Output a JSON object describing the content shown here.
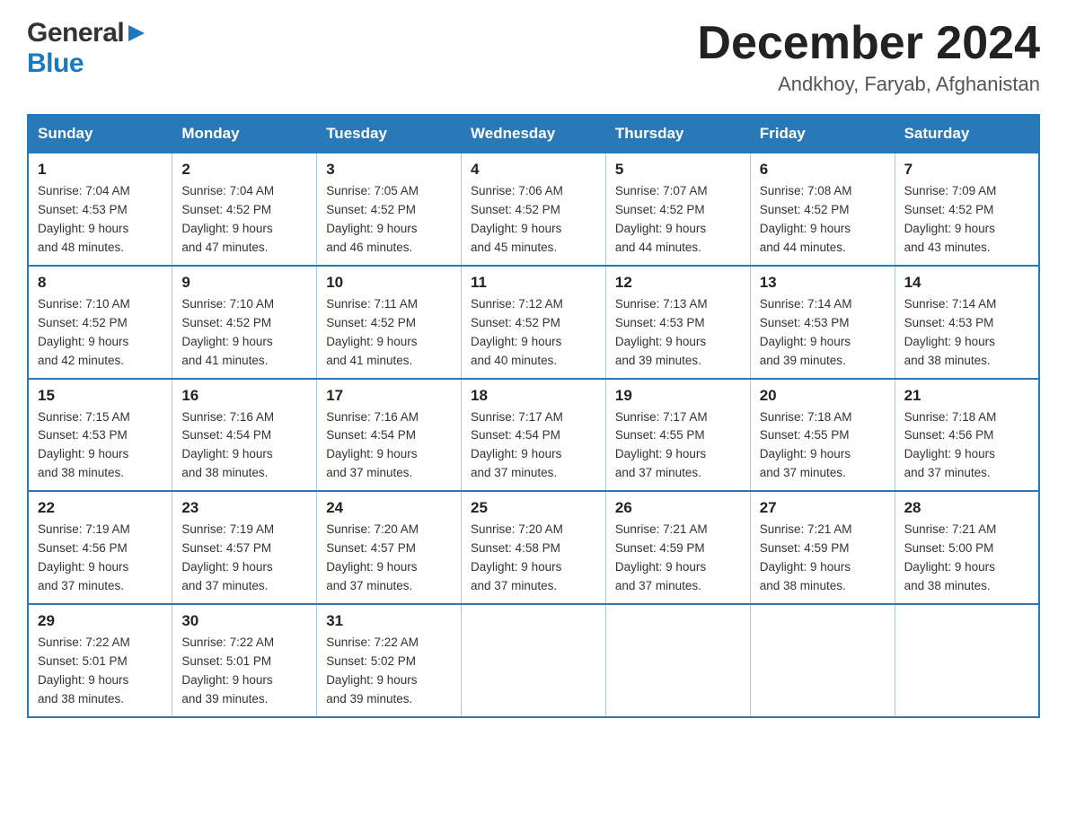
{
  "header": {
    "logo": {
      "general": "General",
      "blue": "Blue",
      "arrow_unicode": "▶"
    },
    "title": "December 2024",
    "location": "Andkhoy, Faryab, Afghanistan"
  },
  "calendar": {
    "days_of_week": [
      "Sunday",
      "Monday",
      "Tuesday",
      "Wednesday",
      "Thursday",
      "Friday",
      "Saturday"
    ],
    "weeks": [
      [
        {
          "date": "1",
          "sunrise": "7:04 AM",
          "sunset": "4:53 PM",
          "daylight": "9 hours and 48 minutes."
        },
        {
          "date": "2",
          "sunrise": "7:04 AM",
          "sunset": "4:52 PM",
          "daylight": "9 hours and 47 minutes."
        },
        {
          "date": "3",
          "sunrise": "7:05 AM",
          "sunset": "4:52 PM",
          "daylight": "9 hours and 46 minutes."
        },
        {
          "date": "4",
          "sunrise": "7:06 AM",
          "sunset": "4:52 PM",
          "daylight": "9 hours and 45 minutes."
        },
        {
          "date": "5",
          "sunrise": "7:07 AM",
          "sunset": "4:52 PM",
          "daylight": "9 hours and 44 minutes."
        },
        {
          "date": "6",
          "sunrise": "7:08 AM",
          "sunset": "4:52 PM",
          "daylight": "9 hours and 44 minutes."
        },
        {
          "date": "7",
          "sunrise": "7:09 AM",
          "sunset": "4:52 PM",
          "daylight": "9 hours and 43 minutes."
        }
      ],
      [
        {
          "date": "8",
          "sunrise": "7:10 AM",
          "sunset": "4:52 PM",
          "daylight": "9 hours and 42 minutes."
        },
        {
          "date": "9",
          "sunrise": "7:10 AM",
          "sunset": "4:52 PM",
          "daylight": "9 hours and 41 minutes."
        },
        {
          "date": "10",
          "sunrise": "7:11 AM",
          "sunset": "4:52 PM",
          "daylight": "9 hours and 41 minutes."
        },
        {
          "date": "11",
          "sunrise": "7:12 AM",
          "sunset": "4:52 PM",
          "daylight": "9 hours and 40 minutes."
        },
        {
          "date": "12",
          "sunrise": "7:13 AM",
          "sunset": "4:53 PM",
          "daylight": "9 hours and 39 minutes."
        },
        {
          "date": "13",
          "sunrise": "7:14 AM",
          "sunset": "4:53 PM",
          "daylight": "9 hours and 39 minutes."
        },
        {
          "date": "14",
          "sunrise": "7:14 AM",
          "sunset": "4:53 PM",
          "daylight": "9 hours and 38 minutes."
        }
      ],
      [
        {
          "date": "15",
          "sunrise": "7:15 AM",
          "sunset": "4:53 PM",
          "daylight": "9 hours and 38 minutes."
        },
        {
          "date": "16",
          "sunrise": "7:16 AM",
          "sunset": "4:54 PM",
          "daylight": "9 hours and 38 minutes."
        },
        {
          "date": "17",
          "sunrise": "7:16 AM",
          "sunset": "4:54 PM",
          "daylight": "9 hours and 37 minutes."
        },
        {
          "date": "18",
          "sunrise": "7:17 AM",
          "sunset": "4:54 PM",
          "daylight": "9 hours and 37 minutes."
        },
        {
          "date": "19",
          "sunrise": "7:17 AM",
          "sunset": "4:55 PM",
          "daylight": "9 hours and 37 minutes."
        },
        {
          "date": "20",
          "sunrise": "7:18 AM",
          "sunset": "4:55 PM",
          "daylight": "9 hours and 37 minutes."
        },
        {
          "date": "21",
          "sunrise": "7:18 AM",
          "sunset": "4:56 PM",
          "daylight": "9 hours and 37 minutes."
        }
      ],
      [
        {
          "date": "22",
          "sunrise": "7:19 AM",
          "sunset": "4:56 PM",
          "daylight": "9 hours and 37 minutes."
        },
        {
          "date": "23",
          "sunrise": "7:19 AM",
          "sunset": "4:57 PM",
          "daylight": "9 hours and 37 minutes."
        },
        {
          "date": "24",
          "sunrise": "7:20 AM",
          "sunset": "4:57 PM",
          "daylight": "9 hours and 37 minutes."
        },
        {
          "date": "25",
          "sunrise": "7:20 AM",
          "sunset": "4:58 PM",
          "daylight": "9 hours and 37 minutes."
        },
        {
          "date": "26",
          "sunrise": "7:21 AM",
          "sunset": "4:59 PM",
          "daylight": "9 hours and 37 minutes."
        },
        {
          "date": "27",
          "sunrise": "7:21 AM",
          "sunset": "4:59 PM",
          "daylight": "9 hours and 38 minutes."
        },
        {
          "date": "28",
          "sunrise": "7:21 AM",
          "sunset": "5:00 PM",
          "daylight": "9 hours and 38 minutes."
        }
      ],
      [
        {
          "date": "29",
          "sunrise": "7:22 AM",
          "sunset": "5:01 PM",
          "daylight": "9 hours and 38 minutes."
        },
        {
          "date": "30",
          "sunrise": "7:22 AM",
          "sunset": "5:01 PM",
          "daylight": "9 hours and 39 minutes."
        },
        {
          "date": "31",
          "sunrise": "7:22 AM",
          "sunset": "5:02 PM",
          "daylight": "9 hours and 39 minutes."
        },
        null,
        null,
        null,
        null
      ]
    ],
    "labels": {
      "sunrise": "Sunrise:",
      "sunset": "Sunset:",
      "daylight": "Daylight:"
    }
  }
}
